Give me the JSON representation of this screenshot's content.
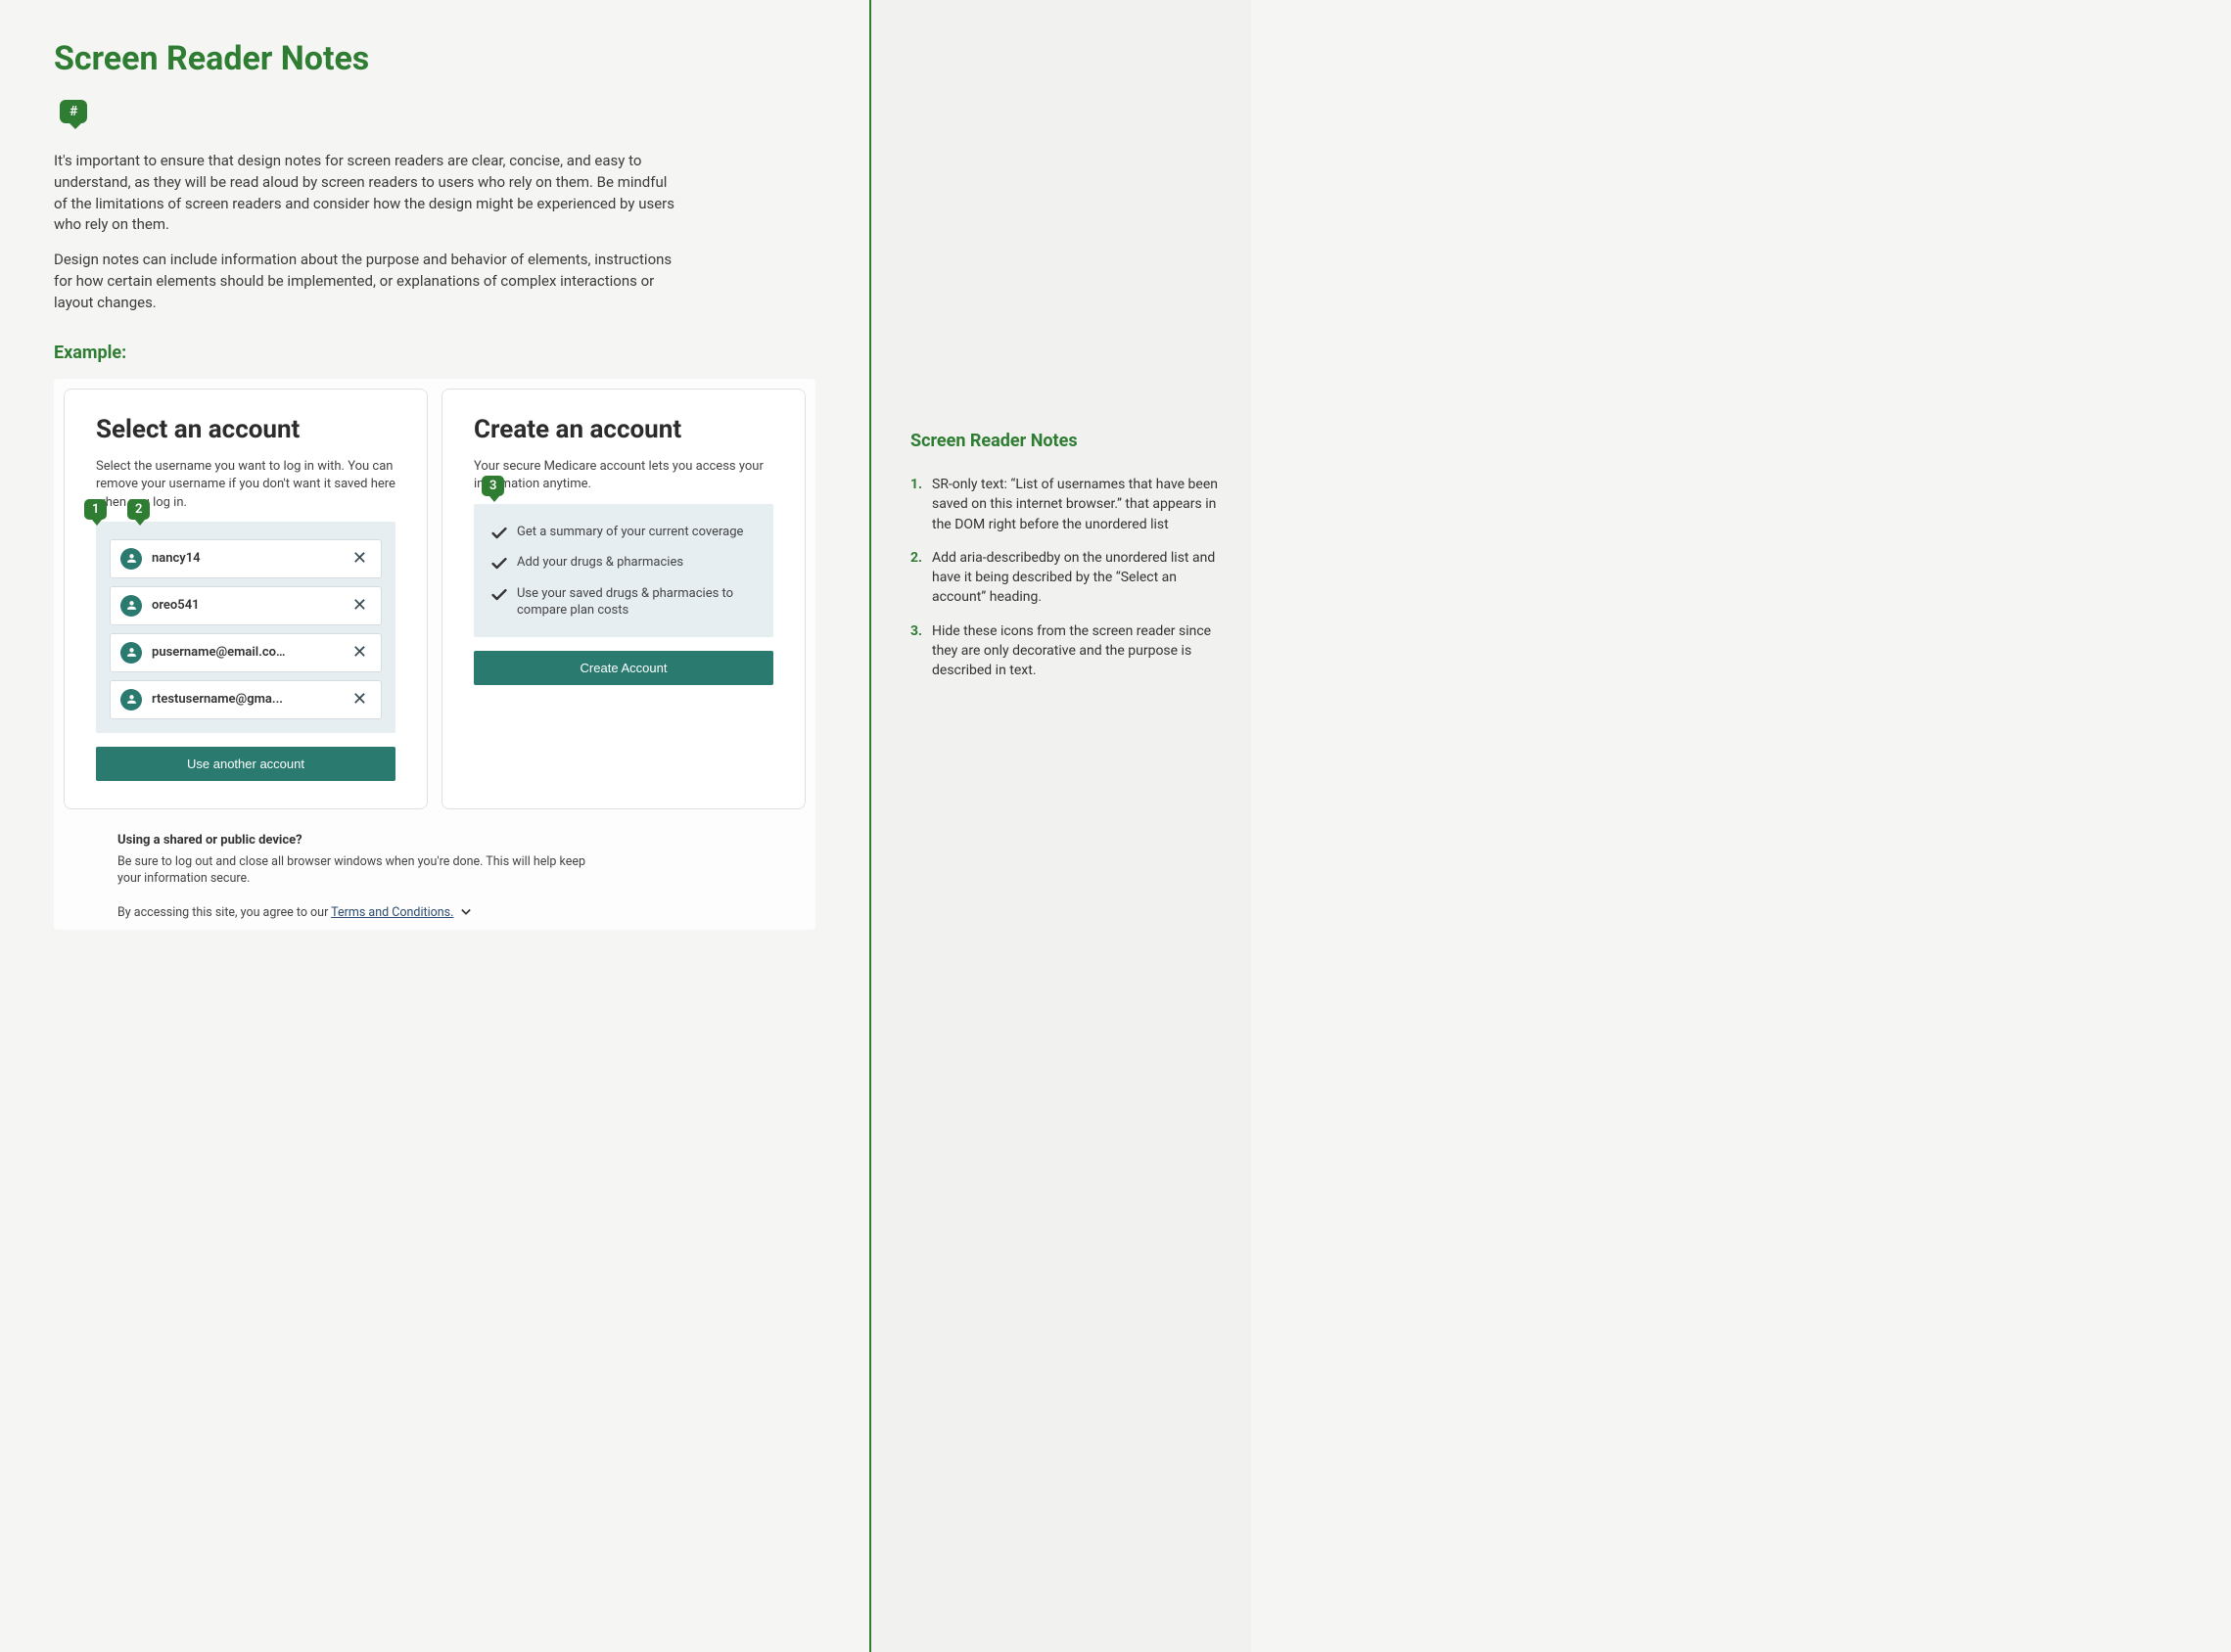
{
  "page": {
    "title": "Screen Reader Notes",
    "hash_label": "#",
    "intro_p1": "It's important to ensure that design notes for screen readers are clear, concise, and easy to understand, as they will be read aloud by screen readers to users who rely on them. Be mindful of the limitations of screen readers and consider how the design might be experienced by users who rely on them.",
    "intro_p2": "Design notes can include information about the purpose and behavior of elements, instructions for how certain elements should be implemented, or explanations of complex interactions or layout changes.",
    "example_heading": "Example:"
  },
  "example": {
    "select_card": {
      "heading": "Select an account",
      "sub": "Select the username you want to log in with. You can remove your username if you don't want it saved here when you log in.",
      "accounts": [
        {
          "username": "nancy14"
        },
        {
          "username": "oreo541"
        },
        {
          "username": "pusername@email.co…"
        },
        {
          "username": "rtestusername@gma..."
        }
      ],
      "use_another_label": "Use another account"
    },
    "create_card": {
      "heading": "Create an account",
      "sub": "Your secure Medicare account lets you access your information anytime.",
      "benefits": [
        "Get a summary of your current coverage",
        "Add your drugs & pharmacies",
        "Use your saved drugs & pharmacies to compare plan costs"
      ],
      "create_button_label": "Create Account"
    },
    "annotations": {
      "b1": "1",
      "b2": "2",
      "b3": "3"
    },
    "below": {
      "shared_heading": "Using a shared or public device?",
      "shared_text": "Be sure to log out and close all browser windows when you're done. This will help keep your information secure.",
      "agree_prefix": "By accessing this site, you agree to our ",
      "terms_link": "Terms and Conditions."
    }
  },
  "sidebar": {
    "heading": "Screen Reader Notes",
    "notes": [
      "SR-only text: “List of usernames that have been saved on this internet browser.” that appears in the DOM right before the unordered list",
      "Add aria-describedby on the unordered list and have it being described by the “Select an account” heading.",
      "Hide these icons from the screen reader since they are only decorative and the purpose is described in text."
    ]
  }
}
